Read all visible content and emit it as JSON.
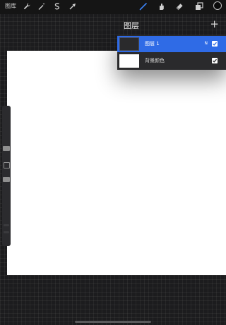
{
  "toolbar": {
    "gallery_label": "图库",
    "tools": [
      {
        "name": "wrench-icon",
        "active": false
      },
      {
        "name": "magic-wand-icon",
        "active": false
      },
      {
        "name": "selection-icon",
        "active": false
      },
      {
        "name": "transform-arrow-icon",
        "active": false
      },
      {
        "name": "brush-icon",
        "active": true
      },
      {
        "name": "smudge-icon",
        "active": false
      },
      {
        "name": "eraser-icon",
        "active": false
      },
      {
        "name": "layers-icon",
        "active": false
      }
    ],
    "current_color": "#0a0a0a",
    "active_color": "#3b82f6"
  },
  "layers_panel": {
    "title": "图层",
    "add_label": "+",
    "layers": [
      {
        "name": "图层 1",
        "blend_mode": "N",
        "visible": true,
        "selected": true,
        "thumb_color": "#2a2a2c"
      },
      {
        "name": "背景颜色",
        "visible": true,
        "selected": false,
        "thumb_color": "#ffffff"
      }
    ],
    "selected_color": "#2f6be6"
  }
}
